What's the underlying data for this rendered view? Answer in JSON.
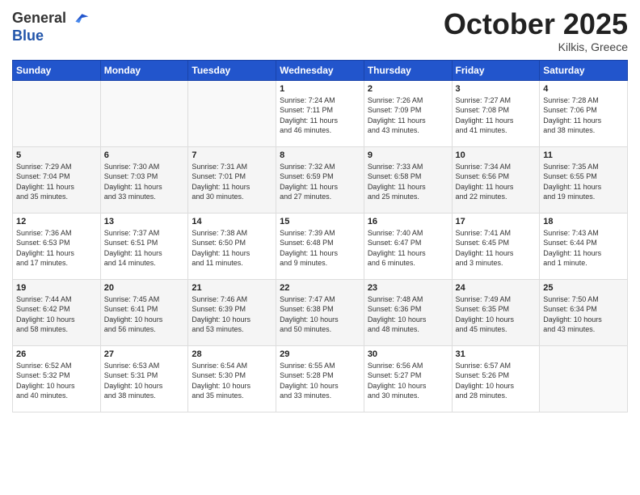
{
  "header": {
    "logo_line1": "General",
    "logo_line2": "Blue",
    "month": "October 2025",
    "location": "Kilkis, Greece"
  },
  "days_of_week": [
    "Sunday",
    "Monday",
    "Tuesday",
    "Wednesday",
    "Thursday",
    "Friday",
    "Saturday"
  ],
  "weeks": [
    [
      {
        "day": "",
        "info": ""
      },
      {
        "day": "",
        "info": ""
      },
      {
        "day": "",
        "info": ""
      },
      {
        "day": "1",
        "info": "Sunrise: 7:24 AM\nSunset: 7:11 PM\nDaylight: 11 hours\nand 46 minutes."
      },
      {
        "day": "2",
        "info": "Sunrise: 7:26 AM\nSunset: 7:09 PM\nDaylight: 11 hours\nand 43 minutes."
      },
      {
        "day": "3",
        "info": "Sunrise: 7:27 AM\nSunset: 7:08 PM\nDaylight: 11 hours\nand 41 minutes."
      },
      {
        "day": "4",
        "info": "Sunrise: 7:28 AM\nSunset: 7:06 PM\nDaylight: 11 hours\nand 38 minutes."
      }
    ],
    [
      {
        "day": "5",
        "info": "Sunrise: 7:29 AM\nSunset: 7:04 PM\nDaylight: 11 hours\nand 35 minutes."
      },
      {
        "day": "6",
        "info": "Sunrise: 7:30 AM\nSunset: 7:03 PM\nDaylight: 11 hours\nand 33 minutes."
      },
      {
        "day": "7",
        "info": "Sunrise: 7:31 AM\nSunset: 7:01 PM\nDaylight: 11 hours\nand 30 minutes."
      },
      {
        "day": "8",
        "info": "Sunrise: 7:32 AM\nSunset: 6:59 PM\nDaylight: 11 hours\nand 27 minutes."
      },
      {
        "day": "9",
        "info": "Sunrise: 7:33 AM\nSunset: 6:58 PM\nDaylight: 11 hours\nand 25 minutes."
      },
      {
        "day": "10",
        "info": "Sunrise: 7:34 AM\nSunset: 6:56 PM\nDaylight: 11 hours\nand 22 minutes."
      },
      {
        "day": "11",
        "info": "Sunrise: 7:35 AM\nSunset: 6:55 PM\nDaylight: 11 hours\nand 19 minutes."
      }
    ],
    [
      {
        "day": "12",
        "info": "Sunrise: 7:36 AM\nSunset: 6:53 PM\nDaylight: 11 hours\nand 17 minutes."
      },
      {
        "day": "13",
        "info": "Sunrise: 7:37 AM\nSunset: 6:51 PM\nDaylight: 11 hours\nand 14 minutes."
      },
      {
        "day": "14",
        "info": "Sunrise: 7:38 AM\nSunset: 6:50 PM\nDaylight: 11 hours\nand 11 minutes."
      },
      {
        "day": "15",
        "info": "Sunrise: 7:39 AM\nSunset: 6:48 PM\nDaylight: 11 hours\nand 9 minutes."
      },
      {
        "day": "16",
        "info": "Sunrise: 7:40 AM\nSunset: 6:47 PM\nDaylight: 11 hours\nand 6 minutes."
      },
      {
        "day": "17",
        "info": "Sunrise: 7:41 AM\nSunset: 6:45 PM\nDaylight: 11 hours\nand 3 minutes."
      },
      {
        "day": "18",
        "info": "Sunrise: 7:43 AM\nSunset: 6:44 PM\nDaylight: 11 hours\nand 1 minute."
      }
    ],
    [
      {
        "day": "19",
        "info": "Sunrise: 7:44 AM\nSunset: 6:42 PM\nDaylight: 10 hours\nand 58 minutes."
      },
      {
        "day": "20",
        "info": "Sunrise: 7:45 AM\nSunset: 6:41 PM\nDaylight: 10 hours\nand 56 minutes."
      },
      {
        "day": "21",
        "info": "Sunrise: 7:46 AM\nSunset: 6:39 PM\nDaylight: 10 hours\nand 53 minutes."
      },
      {
        "day": "22",
        "info": "Sunrise: 7:47 AM\nSunset: 6:38 PM\nDaylight: 10 hours\nand 50 minutes."
      },
      {
        "day": "23",
        "info": "Sunrise: 7:48 AM\nSunset: 6:36 PM\nDaylight: 10 hours\nand 48 minutes."
      },
      {
        "day": "24",
        "info": "Sunrise: 7:49 AM\nSunset: 6:35 PM\nDaylight: 10 hours\nand 45 minutes."
      },
      {
        "day": "25",
        "info": "Sunrise: 7:50 AM\nSunset: 6:34 PM\nDaylight: 10 hours\nand 43 minutes."
      }
    ],
    [
      {
        "day": "26",
        "info": "Sunrise: 6:52 AM\nSunset: 5:32 PM\nDaylight: 10 hours\nand 40 minutes."
      },
      {
        "day": "27",
        "info": "Sunrise: 6:53 AM\nSunset: 5:31 PM\nDaylight: 10 hours\nand 38 minutes."
      },
      {
        "day": "28",
        "info": "Sunrise: 6:54 AM\nSunset: 5:30 PM\nDaylight: 10 hours\nand 35 minutes."
      },
      {
        "day": "29",
        "info": "Sunrise: 6:55 AM\nSunset: 5:28 PM\nDaylight: 10 hours\nand 33 minutes."
      },
      {
        "day": "30",
        "info": "Sunrise: 6:56 AM\nSunset: 5:27 PM\nDaylight: 10 hours\nand 30 minutes."
      },
      {
        "day": "31",
        "info": "Sunrise: 6:57 AM\nSunset: 5:26 PM\nDaylight: 10 hours\nand 28 minutes."
      },
      {
        "day": "",
        "info": ""
      }
    ]
  ]
}
